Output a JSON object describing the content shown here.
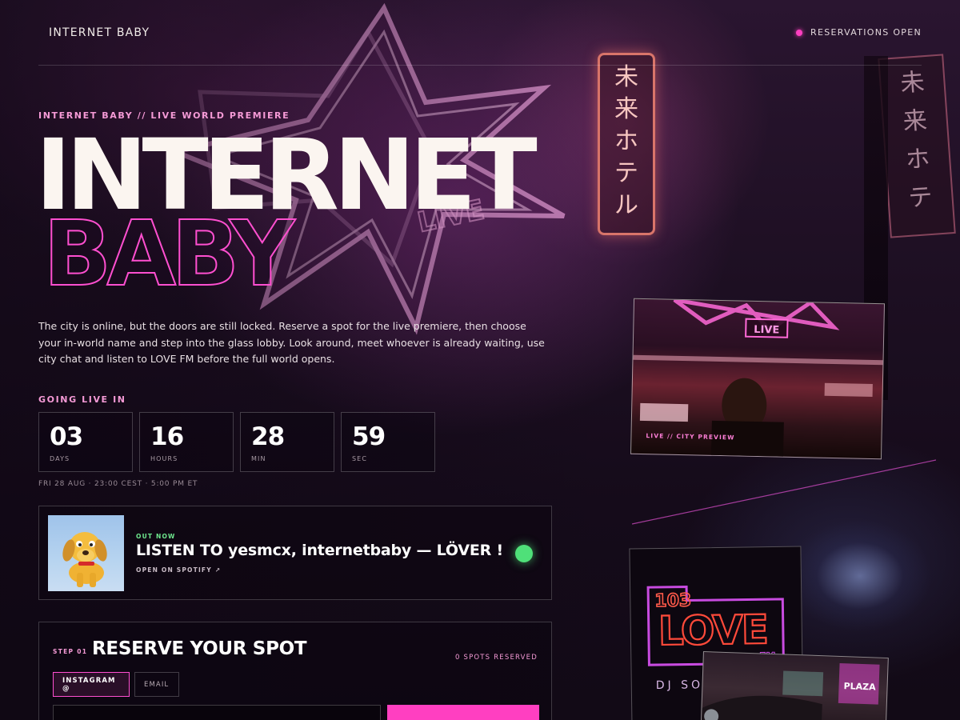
{
  "header": {
    "brand": "INTERNET BABY",
    "status_text": "RESERVATIONS OPEN",
    "status_color": "#ff3fc1"
  },
  "hero": {
    "eyebrow": "INTERNET BABY // LIVE WORLD PREMIERE",
    "title_line_1": "INTERNET",
    "title_line_2": "BABY",
    "intro": "The city is online, but the doors are still locked. Reserve a spot for the live premiere, then choose your in-world name and step into the glass lobby. Look around, meet whoever is already waiting, use city chat and listen to LOVE FM before the full world opens."
  },
  "countdown": {
    "label": "GOING LIVE IN",
    "units": [
      {
        "value": "03",
        "label": "DAYS"
      },
      {
        "value": "16",
        "label": "HOURS"
      },
      {
        "value": "28",
        "label": "MIN"
      },
      {
        "value": "59",
        "label": "SEC"
      }
    ],
    "event_time": "FRI 28 AUG · 23:00 CEST · 5:00 PM ET"
  },
  "spotify": {
    "out_now": "OUT NOW",
    "title": "LISTEN TO yesmcx, internetbaby — LÖVER !",
    "link": "OPEN ON SPOTIFY ↗",
    "indicator_color": "#4fe079",
    "cover_icon": "yellow-dog-cover"
  },
  "reserve": {
    "step_label": "STEP 01",
    "title": "RESERVE YOUR SPOT",
    "spots_reserved": "0 SPOTS RESERVED",
    "tabs": [
      {
        "label": "INSTAGRAM @",
        "active": true
      },
      {
        "label": "EMAIL",
        "active": false
      }
    ],
    "input_value": "",
    "accent": "#ff3fc1"
  },
  "gallery": {
    "preview_caption": "LIVE // CITY PREVIEW",
    "live_sign": "LIVE",
    "love_sign": {
      "number": "103",
      "word": "LOVE",
      "suffix": "FM",
      "sub": "DJ SO"
    },
    "car_sign": "PLAZA"
  },
  "backdrop": {
    "star_sign_text": "LIVE",
    "vertical_sign_1": [
      "未",
      "来",
      "ホ",
      "テ",
      "ル"
    ],
    "vertical_sign_2": [
      "未",
      "来",
      "ホ",
      "テ"
    ]
  }
}
